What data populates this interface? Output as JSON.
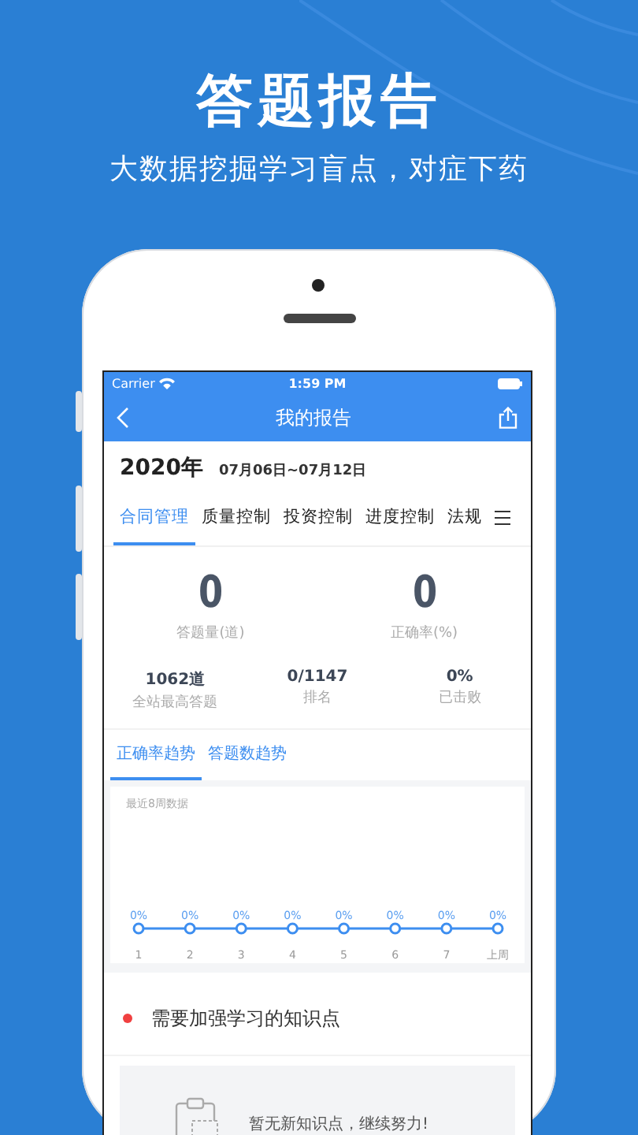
{
  "banner": {
    "title": "答题报告",
    "subtitle": "大数据挖掘学习盲点，对症下药"
  },
  "status_bar": {
    "carrier": "Carrier",
    "time": "1:59 PM"
  },
  "nav": {
    "title": "我的报告"
  },
  "period": {
    "year": "2020年",
    "range": "07月06日~07月12日"
  },
  "tabs": [
    {
      "label": "合同管理",
      "selected": true
    },
    {
      "label": "质量控制",
      "selected": false
    },
    {
      "label": "投资控制",
      "selected": false
    },
    {
      "label": "进度控制",
      "selected": false
    },
    {
      "label": "法规",
      "selected": false
    }
  ],
  "main_stats": [
    {
      "value": "0",
      "label": "答题量(道)"
    },
    {
      "value": "0",
      "label": "正确率(%)"
    }
  ],
  "sub_stats": [
    {
      "value": "1062道",
      "label": "全站最高答题"
    },
    {
      "value": "0/1147",
      "label": "排名"
    },
    {
      "value": "0%",
      "label": "已击败"
    }
  ],
  "trend_tabs": [
    {
      "label": "正确率趋势",
      "selected": true
    },
    {
      "label": "答题数趋势",
      "selected": false
    }
  ],
  "chart": {
    "caption": "最近8周数据",
    "x_labels": [
      "1",
      "2",
      "3",
      "4",
      "5",
      "6",
      "7",
      "上周"
    ],
    "point_labels": [
      "0%",
      "0%",
      "0%",
      "0%",
      "0%",
      "0%",
      "0%",
      "0%"
    ]
  },
  "weak_points": {
    "title": "需要加强学习的知识点",
    "empty_text": "暂无新知识点，继续努力!"
  }
}
